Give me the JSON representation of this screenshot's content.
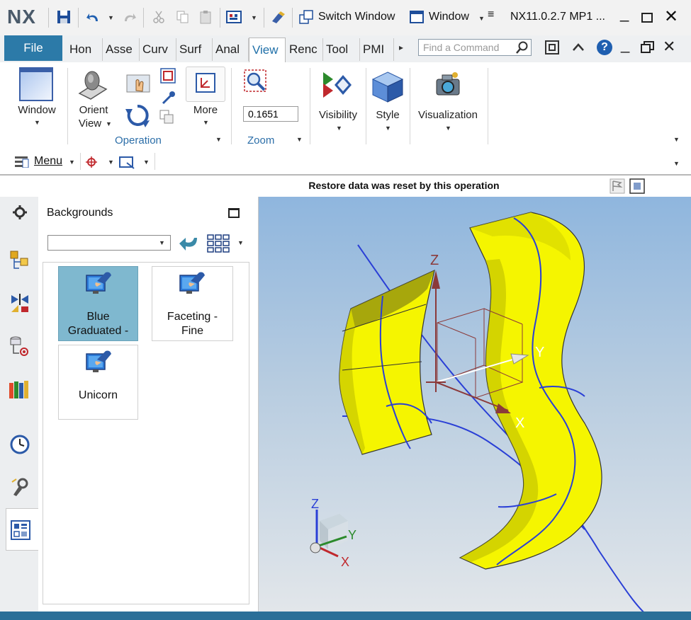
{
  "app": {
    "logo": "NX",
    "title": "NX11.0.2.7 MP1 ...",
    "switch_window": "Switch Window",
    "window_menu": "Window"
  },
  "tabs": {
    "file": "File",
    "items": [
      {
        "label": "Hon"
      },
      {
        "label": "Asse"
      },
      {
        "label": "Curv"
      },
      {
        "label": "Surf"
      },
      {
        "label": "Anal"
      },
      {
        "label": "View"
      },
      {
        "label": "Renc"
      },
      {
        "label": "Tool"
      },
      {
        "label": "PMI"
      }
    ],
    "find_command_placeholder": "Find a Command"
  },
  "ribbon": {
    "window": "Window",
    "orient_view_1": "Orient",
    "orient_view_2": "View",
    "more": "More",
    "operation": "Operation",
    "zoom_value": "0.1651",
    "zoom": "Zoom",
    "visibility": "Visibility",
    "style": "Style",
    "visualization": "Visualization"
  },
  "menubar": {
    "menu": "Menu"
  },
  "status": {
    "message": "Restore data was reset by this operation"
  },
  "panel": {
    "title": "Backgrounds",
    "dropdown_value": "",
    "tiles": [
      {
        "line1": "Blue",
        "line2": "Graduated -"
      },
      {
        "line1": "Faceting -",
        "line2": "Fine"
      },
      {
        "line1": "Unicorn",
        "line2": ""
      }
    ]
  },
  "viewport": {
    "axis_z": "Z",
    "axis_y": "Y",
    "axis_x": "X",
    "triad_z": "Z",
    "triad_y": "Y",
    "triad_x": "X"
  },
  "colors": {
    "accent": "#2c7aa8",
    "surface": "#f5f500",
    "curve": "#2a3fd6",
    "group_label": "#2c6ea8"
  }
}
